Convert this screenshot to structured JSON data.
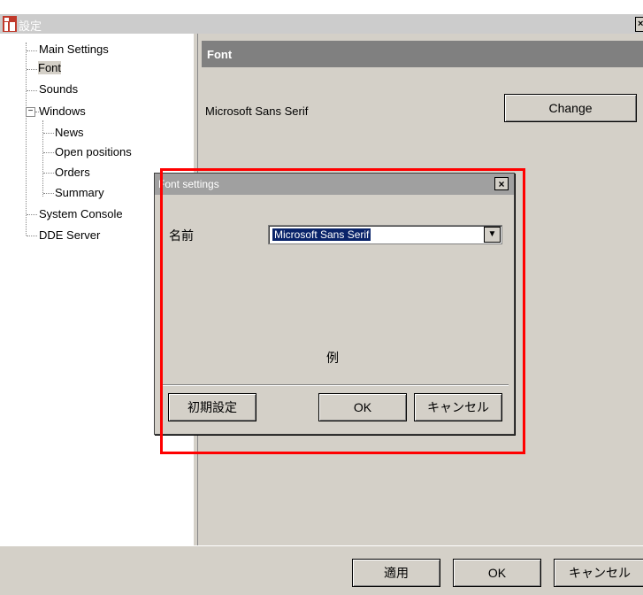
{
  "window": {
    "title": "設定",
    "close_glyph": "×"
  },
  "tree": {
    "items": [
      {
        "label": "Main Settings"
      },
      {
        "label": "Font"
      },
      {
        "label": "Sounds"
      },
      {
        "label": "Windows"
      },
      {
        "label": "News"
      },
      {
        "label": "Open positions"
      },
      {
        "label": "Orders"
      },
      {
        "label": "Summary"
      },
      {
        "label": "System Console"
      },
      {
        "label": "DDE Server"
      }
    ],
    "expander": "−"
  },
  "panel": {
    "header": "Font",
    "font_name": "Microsoft Sans Serif",
    "change_label": "Change"
  },
  "bottom": {
    "apply_label": "適用",
    "ok_label": "OK",
    "cancel_label": "キャンセル"
  },
  "dialog": {
    "title": "Font settings",
    "close_glyph": "×",
    "name_label": "名前",
    "selected_font": "Microsoft Sans Serif",
    "dropdown_arrow": "▼",
    "sample": "例",
    "reset_label": "初期設定",
    "ok_label": "OK",
    "cancel_label": "キャンセル"
  },
  "colors": {
    "highlight": "#ff0000",
    "selection": "#0a246a"
  }
}
